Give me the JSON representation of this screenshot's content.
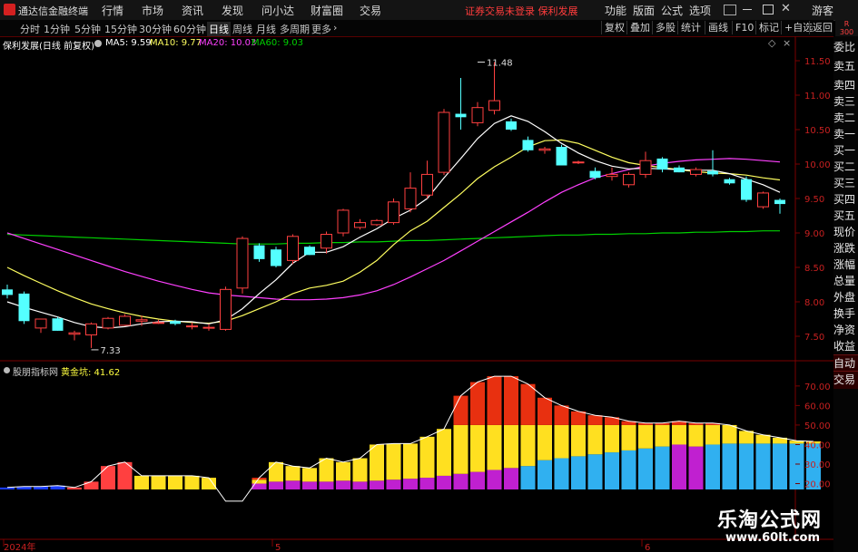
{
  "titlebar": {
    "app_name": "通达信金融终端",
    "menus": [
      "行情",
      "市场",
      "资讯",
      "发现",
      "问小达",
      "财富圈",
      "交易"
    ],
    "notice": "证券交易未登录  保利发展",
    "right_menus": [
      "功能",
      "版面",
      "公式",
      "选项"
    ],
    "user": "游客"
  },
  "toolbar": {
    "periods": [
      "分时",
      "1分钟",
      "5分钟",
      "15分钟",
      "30分钟",
      "60分钟",
      "日线",
      "周线",
      "月线",
      "多周期",
      "更多"
    ],
    "active_period": "日线",
    "buttons": [
      "复权",
      "叠加",
      "多股",
      "统计",
      "画线",
      "F10",
      "标记",
      "+自选",
      "返回"
    ],
    "badge_top": "R",
    "badge_bottom": "300"
  },
  "sidebar": {
    "items": [
      "委比",
      "卖五",
      "卖四",
      "卖三",
      "卖二",
      "卖一",
      "买一",
      "买二",
      "买三",
      "买四",
      "买五",
      "现价",
      "涨跌",
      "涨幅",
      "总量",
      "外盘",
      "换手",
      "净资",
      "收益",
      "自动",
      "交易"
    ]
  },
  "main_legend": {
    "title": "保利发展(日线 前复权)",
    "ma5": "MA5: 9.59",
    "ma10": "MA10: 9.77",
    "ma20": "MA20: 10.03",
    "ma60": "MA60: 9.03"
  },
  "sub_legend": {
    "title": "股朋指标网",
    "label": "黄金坑: 41.62"
  },
  "x_axis": {
    "labels": [
      "2024年",
      "5",
      "6"
    ]
  },
  "watermark": {
    "line1": "乐淘公式网",
    "line2": "www.60lt.com"
  },
  "colors": {
    "up": "#ff4040",
    "down": "#54ffff",
    "ma5": "#ffffff",
    "ma10": "#ffff60",
    "ma20": "#ff40ff",
    "ma60": "#00d000",
    "grid": "#7a0000"
  },
  "chart_data": [
    {
      "type": "candlestick",
      "title": "保利发展(日线 前复权)",
      "ylim": [
        7.25,
        11.75
      ],
      "yticks": [
        7.5,
        8.0,
        8.5,
        9.0,
        9.5,
        10.0,
        10.5,
        11.0,
        11.5
      ],
      "annotations": [
        {
          "label": "11.48",
          "bar": 28,
          "value": 11.48
        },
        {
          "label": "7.33",
          "bar": 5,
          "value": 7.33
        }
      ],
      "candles": [
        {
          "o": 8.18,
          "h": 8.25,
          "l": 8.05,
          "c": 8.1
        },
        {
          "o": 8.12,
          "h": 8.15,
          "l": 7.68,
          "c": 7.72
        },
        {
          "o": 7.62,
          "h": 7.75,
          "l": 7.55,
          "c": 7.75
        },
        {
          "o": 7.76,
          "h": 7.78,
          "l": 7.58,
          "c": 7.58
        },
        {
          "o": 7.53,
          "h": 7.58,
          "l": 7.44,
          "c": 7.55
        },
        {
          "o": 7.52,
          "h": 7.7,
          "l": 7.33,
          "c": 7.68
        },
        {
          "o": 7.62,
          "h": 7.78,
          "l": 7.6,
          "c": 7.76
        },
        {
          "o": 7.66,
          "h": 7.82,
          "l": 7.65,
          "c": 7.79
        },
        {
          "o": 7.72,
          "h": 7.8,
          "l": 7.65,
          "c": 7.74
        },
        {
          "o": 7.7,
          "h": 7.74,
          "l": 7.68,
          "c": 7.7
        },
        {
          "o": 7.72,
          "h": 7.74,
          "l": 7.66,
          "c": 7.68
        },
        {
          "o": 7.65,
          "h": 7.7,
          "l": 7.6,
          "c": 7.65
        },
        {
          "o": 7.63,
          "h": 7.68,
          "l": 7.58,
          "c": 7.63
        },
        {
          "o": 7.6,
          "h": 8.22,
          "l": 7.58,
          "c": 8.18
        },
        {
          "o": 8.2,
          "h": 8.95,
          "l": 8.12,
          "c": 8.92
        },
        {
          "o": 8.82,
          "h": 8.85,
          "l": 8.58,
          "c": 8.62
        },
        {
          "o": 8.76,
          "h": 8.8,
          "l": 8.5,
          "c": 8.52
        },
        {
          "o": 8.6,
          "h": 8.98,
          "l": 8.55,
          "c": 8.95
        },
        {
          "o": 8.8,
          "h": 8.82,
          "l": 8.68,
          "c": 8.68
        },
        {
          "o": 8.78,
          "h": 9.02,
          "l": 8.7,
          "c": 8.98
        },
        {
          "o": 9.0,
          "h": 9.35,
          "l": 8.95,
          "c": 9.33
        },
        {
          "o": 9.08,
          "h": 9.2,
          "l": 9.05,
          "c": 9.15
        },
        {
          "o": 9.12,
          "h": 9.2,
          "l": 9.1,
          "c": 9.18
        },
        {
          "o": 9.15,
          "h": 9.5,
          "l": 9.12,
          "c": 9.45
        },
        {
          "o": 9.35,
          "h": 9.88,
          "l": 9.3,
          "c": 9.65
        },
        {
          "o": 9.55,
          "h": 10.05,
          "l": 9.5,
          "c": 9.85
        },
        {
          "o": 9.88,
          "h": 10.8,
          "l": 9.84,
          "c": 10.75
        },
        {
          "o": 10.73,
          "h": 11.25,
          "l": 10.5,
          "c": 10.68
        },
        {
          "o": 10.6,
          "h": 10.9,
          "l": 10.55,
          "c": 10.82
        },
        {
          "o": 10.78,
          "h": 11.48,
          "l": 10.72,
          "c": 10.92
        },
        {
          "o": 10.62,
          "h": 10.66,
          "l": 10.48,
          "c": 10.5
        },
        {
          "o": 10.35,
          "h": 10.4,
          "l": 10.18,
          "c": 10.2
        },
        {
          "o": 10.2,
          "h": 10.25,
          "l": 10.15,
          "c": 10.22
        },
        {
          "o": 10.25,
          "h": 10.28,
          "l": 9.98,
          "c": 9.98
        },
        {
          "o": 10.02,
          "h": 10.05,
          "l": 10.0,
          "c": 10.03
        },
        {
          "o": 9.9,
          "h": 9.95,
          "l": 9.78,
          "c": 9.8
        },
        {
          "o": 9.82,
          "h": 9.95,
          "l": 9.76,
          "c": 9.85
        },
        {
          "o": 9.7,
          "h": 9.88,
          "l": 9.66,
          "c": 9.85
        },
        {
          "o": 9.85,
          "h": 10.18,
          "l": 9.8,
          "c": 10.05
        },
        {
          "o": 10.08,
          "h": 10.1,
          "l": 9.88,
          "c": 9.92
        },
        {
          "o": 9.95,
          "h": 9.98,
          "l": 9.88,
          "c": 9.88
        },
        {
          "o": 9.85,
          "h": 9.95,
          "l": 9.82,
          "c": 9.92
        },
        {
          "o": 9.9,
          "h": 10.2,
          "l": 9.82,
          "c": 9.85
        },
        {
          "o": 9.78,
          "h": 9.8,
          "l": 9.7,
          "c": 9.72
        },
        {
          "o": 9.78,
          "h": 9.82,
          "l": 9.45,
          "c": 9.48
        },
        {
          "o": 9.38,
          "h": 9.6,
          "l": 9.35,
          "c": 9.58
        },
        {
          "o": 9.48,
          "h": 9.5,
          "l": 9.28,
          "c": 9.42
        }
      ],
      "ma5": [
        8.0,
        7.92,
        7.85,
        7.78,
        7.7,
        7.64,
        7.62,
        7.64,
        7.68,
        7.71,
        7.72,
        7.71,
        7.68,
        7.74,
        7.9,
        8.12,
        8.32,
        8.56,
        8.72,
        8.72,
        8.8,
        8.94,
        9.06,
        9.21,
        9.33,
        9.5,
        9.8,
        10.08,
        10.37,
        10.59,
        10.7,
        10.62,
        10.47,
        10.3,
        10.16,
        10.05,
        9.97,
        9.93,
        9.94,
        9.93,
        9.92,
        9.91,
        9.91,
        9.86,
        9.78,
        9.7,
        9.59
      ],
      "ma10": [
        8.5,
        8.38,
        8.27,
        8.16,
        8.06,
        7.97,
        7.9,
        7.84,
        7.79,
        7.75,
        7.72,
        7.7,
        7.69,
        7.72,
        7.8,
        7.9,
        8.0,
        8.12,
        8.2,
        8.24,
        8.3,
        8.43,
        8.6,
        8.83,
        9.03,
        9.17,
        9.37,
        9.57,
        9.79,
        9.96,
        10.1,
        10.25,
        10.34,
        10.35,
        10.3,
        10.2,
        10.1,
        10.02,
        9.98,
        9.95,
        9.92,
        9.89,
        9.87,
        9.86,
        9.84,
        9.8,
        9.77
      ],
      "ma20": [
        9.0,
        8.92,
        8.84,
        8.76,
        8.68,
        8.6,
        8.52,
        8.44,
        8.37,
        8.3,
        8.24,
        8.18,
        8.13,
        8.1,
        8.08,
        8.06,
        8.04,
        8.03,
        8.03,
        8.04,
        8.06,
        8.1,
        8.16,
        8.25,
        8.36,
        8.48,
        8.6,
        8.74,
        8.88,
        9.02,
        9.16,
        9.3,
        9.45,
        9.59,
        9.7,
        9.8,
        9.86,
        9.92,
        9.97,
        10.01,
        10.04,
        10.06,
        10.07,
        10.08,
        10.07,
        10.05,
        10.03
      ],
      "ma60": [
        8.98,
        8.97,
        8.96,
        8.95,
        8.94,
        8.93,
        8.92,
        8.91,
        8.9,
        8.89,
        8.88,
        8.87,
        8.86,
        8.85,
        8.84,
        8.84,
        8.84,
        8.85,
        8.85,
        8.86,
        8.86,
        8.87,
        8.87,
        8.88,
        8.89,
        8.89,
        8.9,
        8.91,
        8.92,
        8.93,
        8.94,
        8.95,
        8.96,
        8.97,
        8.97,
        8.98,
        8.98,
        8.99,
        8.99,
        9.0,
        9.0,
        9.01,
        9.01,
        9.02,
        9.02,
        9.03,
        9.03
      ]
    },
    {
      "type": "bar",
      "title": "股朋指标网",
      "series_label": "黄金坑: 41.62",
      "ylim": [
        17,
        82
      ],
      "yticks": [
        20.0,
        30.0,
        40.0,
        50.0,
        60.0,
        70.0
      ],
      "total": [
        18,
        18.5,
        18.5,
        19,
        18,
        21,
        29,
        31,
        24,
        24,
        24,
        24,
        23,
        11,
        11,
        23,
        31,
        29,
        28,
        33,
        31,
        33,
        40,
        40.5,
        40.5,
        44,
        48,
        65,
        72,
        75,
        75,
        71,
        64,
        60,
        57,
        55,
        54,
        52,
        51,
        51,
        52,
        51,
        51,
        50,
        47,
        45,
        43.5,
        42,
        41.62
      ],
      "yellow_top": [
        0,
        0,
        0,
        0,
        0,
        0,
        0,
        0,
        24,
        24,
        24,
        24,
        23,
        0,
        0,
        22,
        31,
        29,
        28,
        33,
        31,
        33,
        40,
        40.5,
        40.5,
        44,
        48,
        50,
        50,
        50,
        50,
        50,
        50,
        50,
        50,
        50,
        50,
        50,
        50,
        50,
        50,
        50,
        50,
        50,
        47,
        45,
        43.5,
        42,
        41.62
      ],
      "base_mid": [
        0,
        0,
        0,
        0,
        0,
        0,
        0,
        0,
        0,
        0,
        0,
        0,
        0,
        0,
        0,
        20,
        21,
        21.5,
        21,
        21,
        21.5,
        21,
        21.5,
        22,
        22.5,
        23,
        24,
        25,
        26,
        27,
        28,
        29,
        32,
        33,
        34,
        35,
        36,
        37,
        38,
        39,
        40,
        39,
        40,
        40.5,
        40.5,
        40.5,
        40.5,
        40.5,
        40.5
      ],
      "base_type": [
        "blue",
        "blue",
        "blue",
        "blue",
        "red",
        "red",
        "red",
        "red",
        "yellow",
        "yellow",
        "yellow",
        "yellow",
        "yellow",
        "navy",
        "navy",
        "magenta",
        "magenta",
        "magenta",
        "magenta",
        "magenta",
        "magenta",
        "magenta",
        "magenta",
        "magenta",
        "magenta",
        "magenta",
        "magenta",
        "magenta",
        "magenta",
        "magenta",
        "magenta",
        "cyan",
        "cyan",
        "cyan",
        "cyan",
        "cyan",
        "cyan",
        "cyan",
        "cyan",
        "cyan",
        "magenta",
        "magenta",
        "cyan",
        "cyan",
        "cyan",
        "cyan",
        "cyan",
        "cyan",
        "cyan"
      ]
    }
  ]
}
